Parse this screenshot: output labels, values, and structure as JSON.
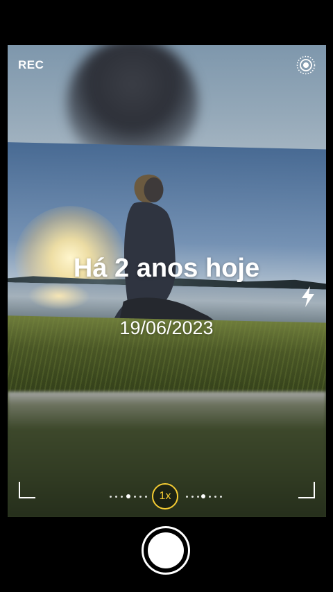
{
  "camera": {
    "rec_label": "REC",
    "live_photo_icon": "live-photo-icon",
    "flash_icon": "flash-icon",
    "zoom_label": "1x",
    "accent_color": "#f5cc33"
  },
  "memory_overlay": {
    "title": "Há 2 anos hoje",
    "date": "19/06/2023"
  }
}
